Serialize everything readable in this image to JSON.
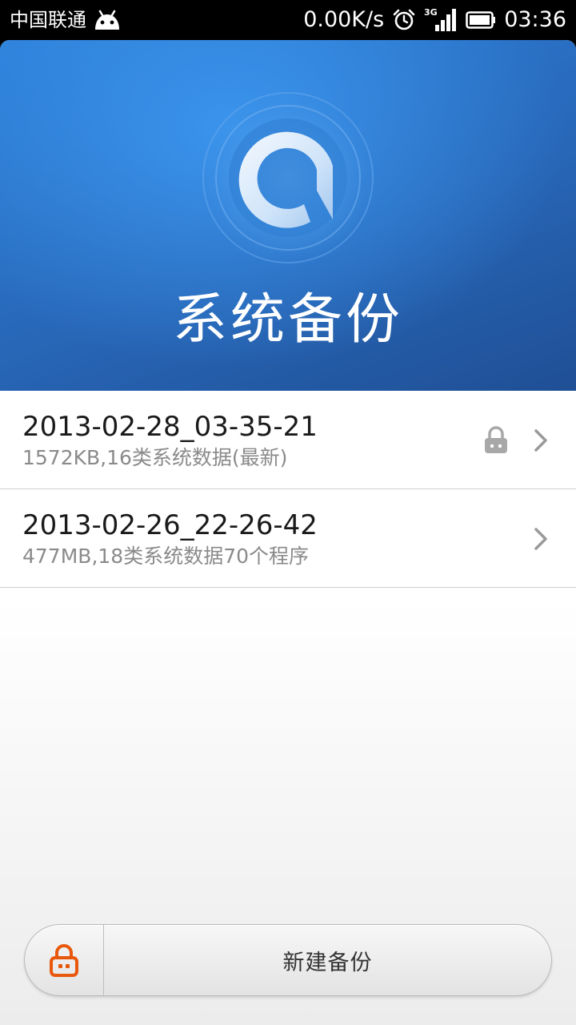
{
  "status_bar": {
    "carrier": "中国联通",
    "net_speed": "0.00K/s",
    "network_type": "3G",
    "time": "03:36",
    "icons": [
      "android-icon",
      "alarm-icon",
      "signal-3g-icon",
      "battery-icon"
    ]
  },
  "header": {
    "title": "系统备份",
    "logo_icon": "backup-logo-icon",
    "colors": {
      "top": "#3b94ec",
      "bottom": "#1f4f95"
    }
  },
  "backups": [
    {
      "name": "2013-02-28_03-35-21",
      "summary": "1572KB,16类系统数据(最新)",
      "locked": true
    },
    {
      "name": "2013-02-26_22-26-42",
      "summary": "477MB,18类系统数据70个程序",
      "locked": false
    }
  ],
  "bottom_bar": {
    "lock_icon": "lock-icon",
    "lock_icon_color": "#e8590c",
    "new_backup_label": "新建备份"
  }
}
